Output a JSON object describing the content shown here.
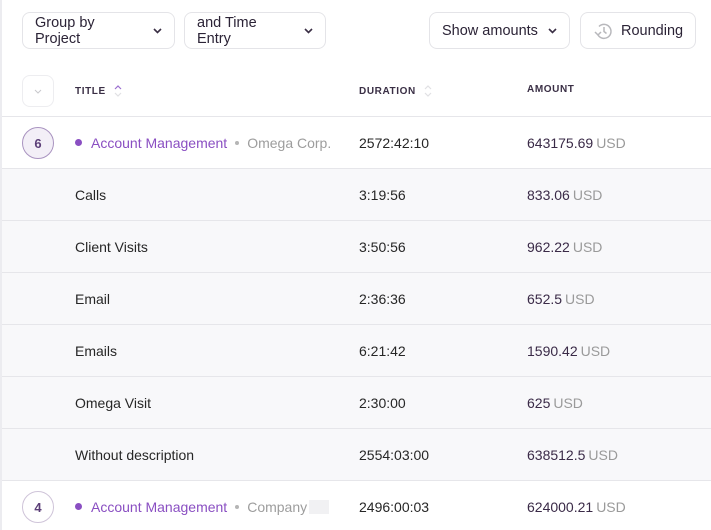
{
  "toolbar": {
    "group_by": "Group by Project",
    "sub_group": "and Time Entry",
    "show_amounts": "Show amounts",
    "rounding": "Rounding"
  },
  "columns": {
    "title": "TITLE",
    "duration": "DURATION",
    "amount": "AMOUNT"
  },
  "colors": {
    "project": "#8a4fc2"
  },
  "rows": [
    {
      "type": "group",
      "count": "6",
      "project": "Account Management",
      "client": "Omega Corp.",
      "duration": "2572:42:10",
      "amount": "643175.69",
      "currency": "USD"
    },
    {
      "type": "child",
      "title": "Calls",
      "duration": "3:19:56",
      "amount": "833.06",
      "currency": "USD"
    },
    {
      "type": "child",
      "title": "Client Visits",
      "duration": "3:50:56",
      "amount": "962.22",
      "currency": "USD"
    },
    {
      "type": "child",
      "title": "Email",
      "duration": "2:36:36",
      "amount": "652.5",
      "currency": "USD"
    },
    {
      "type": "child",
      "title": "Emails",
      "duration": "6:21:42",
      "amount": "1590.42",
      "currency": "USD"
    },
    {
      "type": "child",
      "title": "Omega Visit",
      "duration": "2:30:00",
      "amount": "625",
      "currency": "USD"
    },
    {
      "type": "child",
      "title": "Without description",
      "duration": "2554:03:00",
      "amount": "638512.5",
      "currency": "USD"
    },
    {
      "type": "group",
      "count": "4",
      "project": "Account Management",
      "client": "Company",
      "duration": "2496:00:03",
      "amount": "624000.21",
      "currency": "USD"
    }
  ]
}
